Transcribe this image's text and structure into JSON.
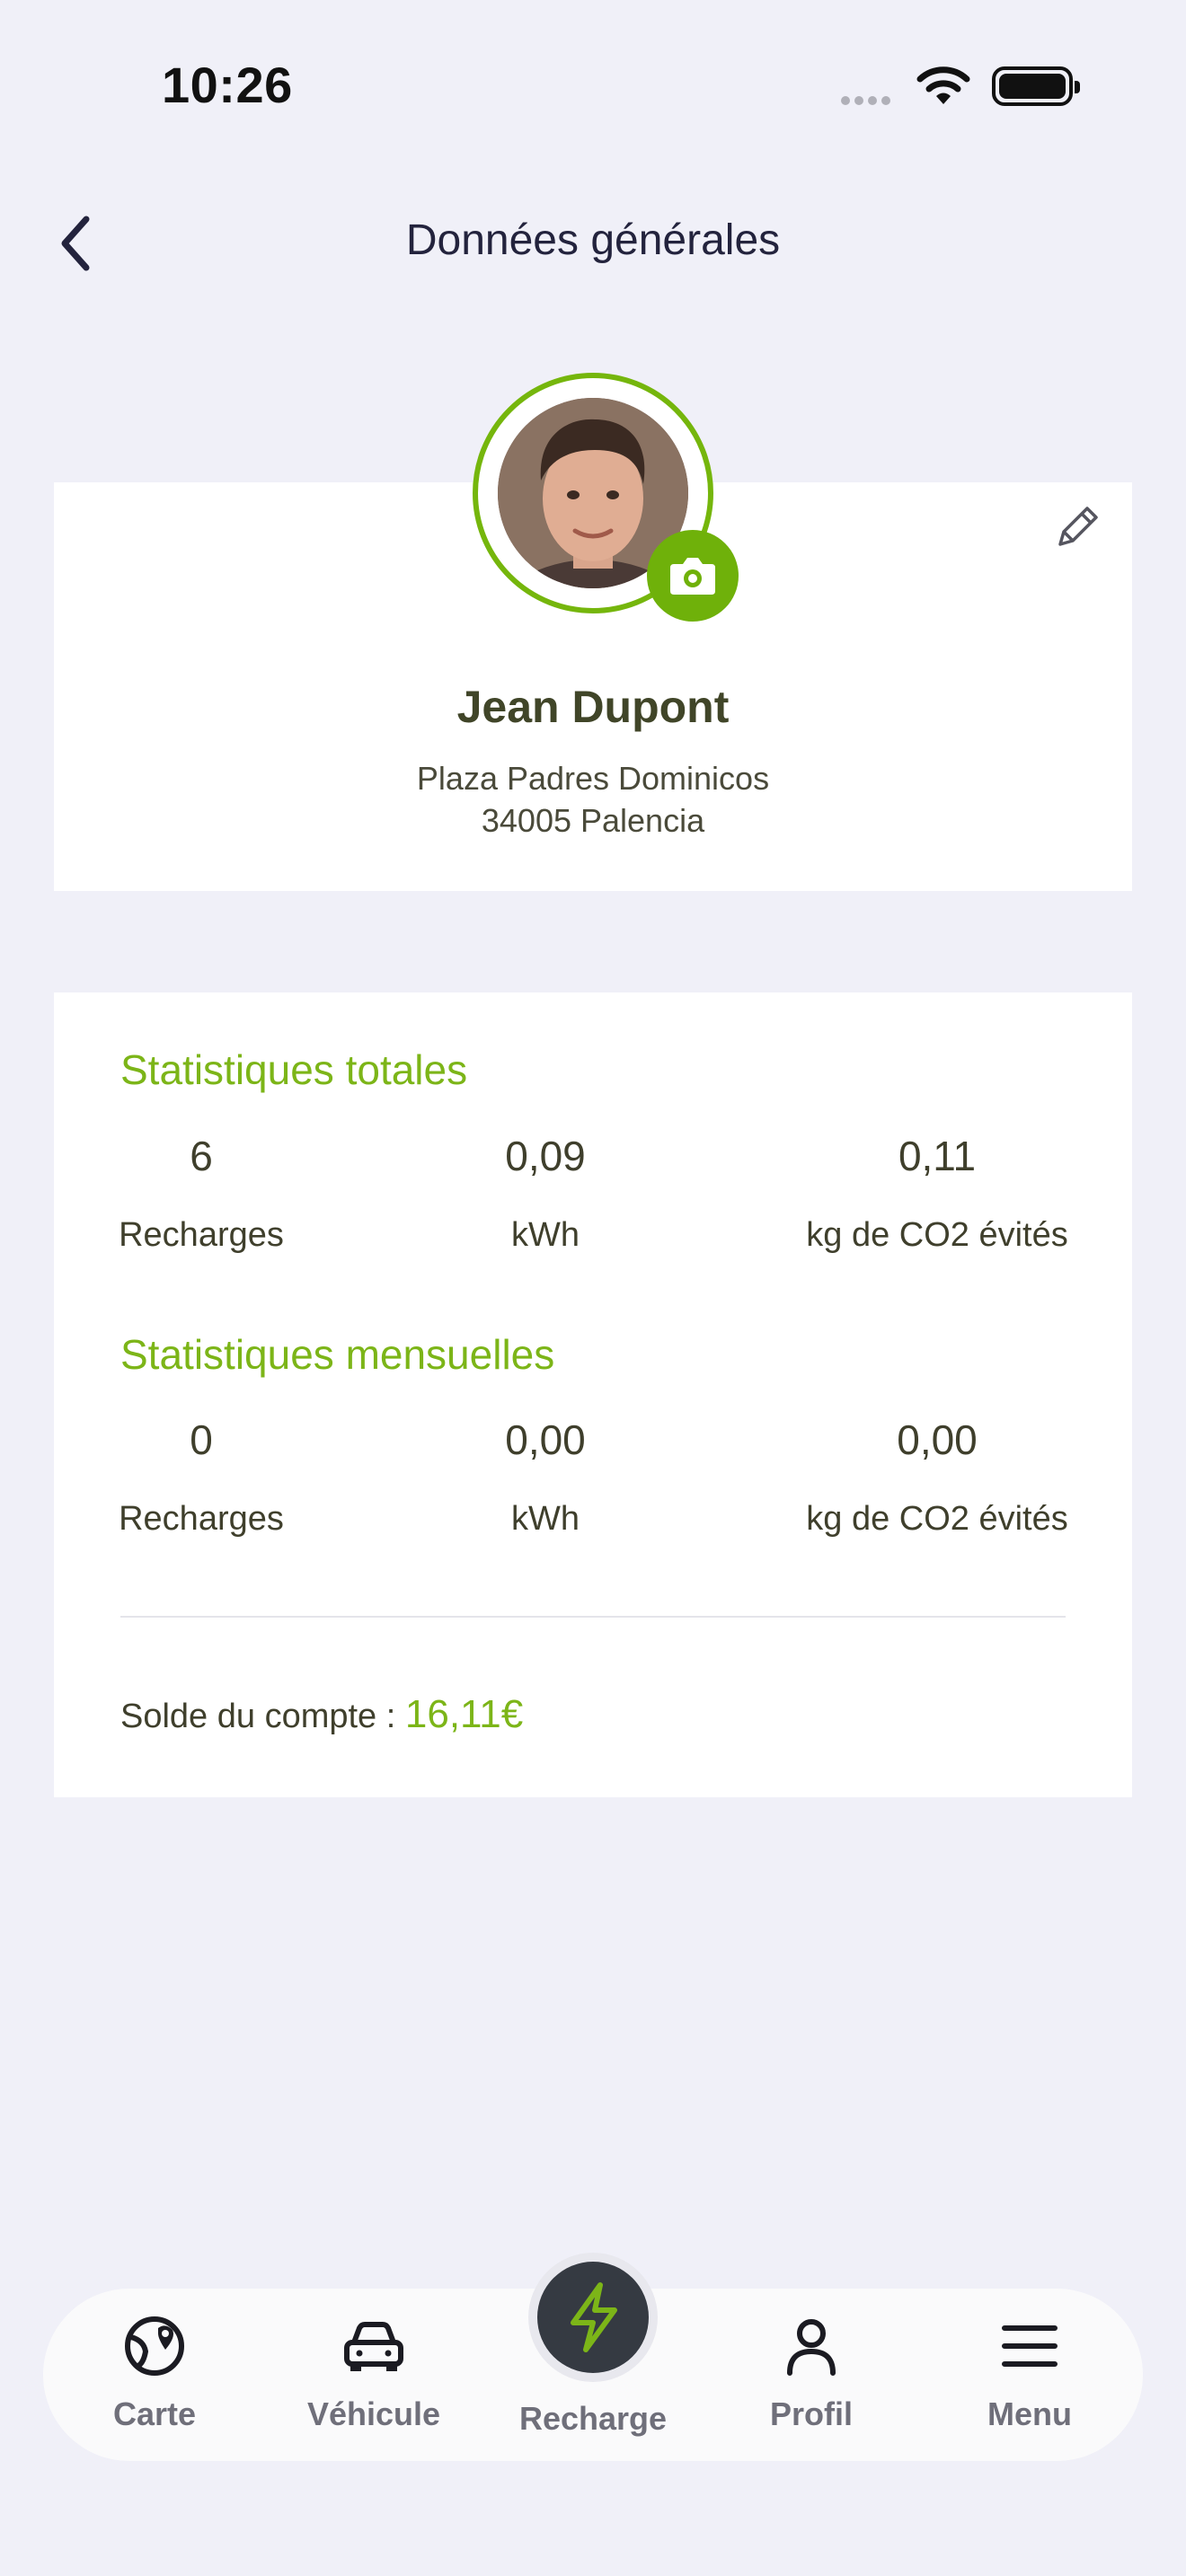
{
  "status_bar": {
    "time": "10:26"
  },
  "header": {
    "title": "Données générales"
  },
  "profile": {
    "name": "Jean Dupont",
    "address_line1": "Plaza Padres Dominicos",
    "address_line2": "34005 Palencia"
  },
  "stats": {
    "total": {
      "title": "Statistiques totales",
      "items": [
        {
          "value": "6",
          "label": "Recharges"
        },
        {
          "value": "0,09",
          "label": "kWh"
        },
        {
          "value": "0,11",
          "label": "kg de CO2 évités"
        }
      ]
    },
    "monthly": {
      "title": "Statistiques mensuelles",
      "items": [
        {
          "value": "0",
          "label": "Recharges"
        },
        {
          "value": "0,00",
          "label": "kWh"
        },
        {
          "value": "0,00",
          "label": "kg de CO2 évités"
        }
      ]
    },
    "balance_label": "Solde du compte :",
    "balance_value": "16,11€"
  },
  "nav": {
    "items": [
      {
        "label": "Carte",
        "icon": "map-pin-globe-icon"
      },
      {
        "label": "Véhicule",
        "icon": "car-icon"
      },
      {
        "label": "Recharge",
        "icon": "lightning-icon"
      },
      {
        "label": "Profil",
        "icon": "user-icon"
      },
      {
        "label": "Menu",
        "icon": "hamburger-menu-icon"
      }
    ]
  },
  "colors": {
    "accent": "#7cb518",
    "background": "#f0f0f8",
    "nav_center": "#353a42"
  }
}
